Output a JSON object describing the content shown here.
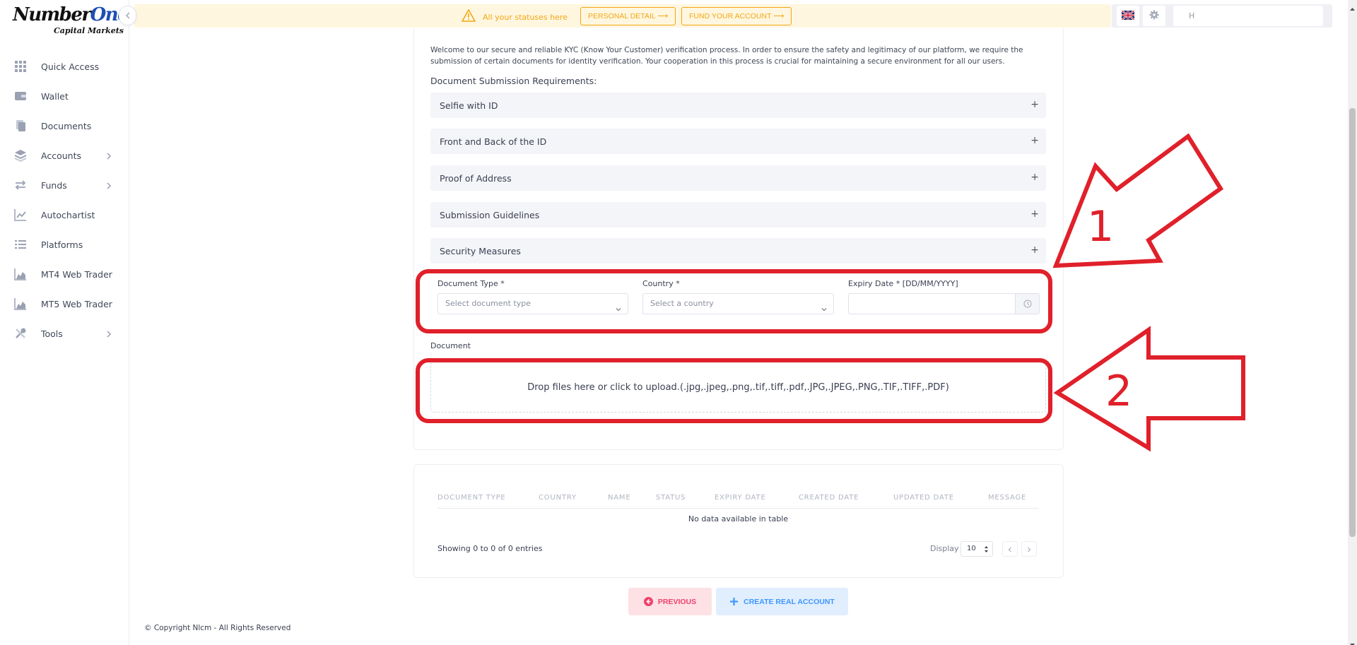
{
  "brand": {
    "name_part1": "Number",
    "name_part2": "One",
    "subtitle": "Capital Markets"
  },
  "sidebar": {
    "items": [
      {
        "label": "Quick Access",
        "icon": "grid-icon",
        "chevron": false
      },
      {
        "label": "Wallet",
        "icon": "wallet-icon",
        "chevron": false
      },
      {
        "label": "Documents",
        "icon": "documents-icon",
        "chevron": false
      },
      {
        "label": "Accounts",
        "icon": "layers-icon",
        "chevron": true
      },
      {
        "label": "Funds",
        "icon": "transfer-icon",
        "chevron": true
      },
      {
        "label": "Autochartist",
        "icon": "chart-line-icon",
        "chevron": false
      },
      {
        "label": "Platforms",
        "icon": "list-icon",
        "chevron": false
      },
      {
        "label": "MT4 Web Trader",
        "icon": "area-chart-icon",
        "chevron": false
      },
      {
        "label": "MT5 Web Trader",
        "icon": "area-chart-icon",
        "chevron": false
      },
      {
        "label": "Tools",
        "icon": "tools-icon",
        "chevron": true
      }
    ]
  },
  "topbar": {
    "status_text": "All your statuses here",
    "personal_detail": "PERSONAL DETAIL ⟶",
    "fund_account": "FUND YOUR ACCOUNT ⟶",
    "user_text": "H"
  },
  "kyc": {
    "intro": "Welcome to our secure and reliable KYC (Know Your Customer) verification process. In order to ensure the safety and legitimacy of our platform, we require the submission of certain documents for identity verification. Your cooperation in this process is crucial for maintaining a secure environment for all our users.",
    "requirements_title": "Document Submission Requirements:",
    "sections": [
      "Selfie with ID",
      "Front and Back of the ID",
      "Proof of Address",
      "Submission Guidelines",
      "Security Measures"
    ],
    "plus": "+",
    "document_type_label": "Document Type *",
    "document_type_placeholder": "Select document type",
    "country_label": "Country *",
    "country_placeholder": "Select a country",
    "expiry_label": "Expiry Date * [DD/MM/YYYY]",
    "document_label": "Document",
    "dropzone_text": "Drop files here or click to upload.(.jpg,.jpeg,.png,.tif,.tiff,.pdf,.JPG,.JPEG,.PNG,.TIF,.TIFF,.PDF)"
  },
  "annotations": {
    "one": "1",
    "two": "2",
    "color": "#e0202a"
  },
  "table": {
    "columns": [
      "DOCUMENT TYPE",
      "COUNTRY",
      "NAME",
      "STATUS",
      "EXPIRY DATE",
      "CREATED DATE",
      "UPDATED DATE",
      "MESSAGE"
    ],
    "empty_text": "No data available in table",
    "showing": "Showing 0 to 0 of 0 entries",
    "display_label": "Display",
    "display_value": "10"
  },
  "actions": {
    "previous": "PREVIOUS",
    "create": "CREATE REAL ACCOUNT"
  },
  "footer": {
    "copyright": "© Copyright Nlcm - All Rights Reserved"
  },
  "colors": {
    "warning": "#f3a712",
    "danger": "#f1416c",
    "primary": "#3e97ff"
  }
}
